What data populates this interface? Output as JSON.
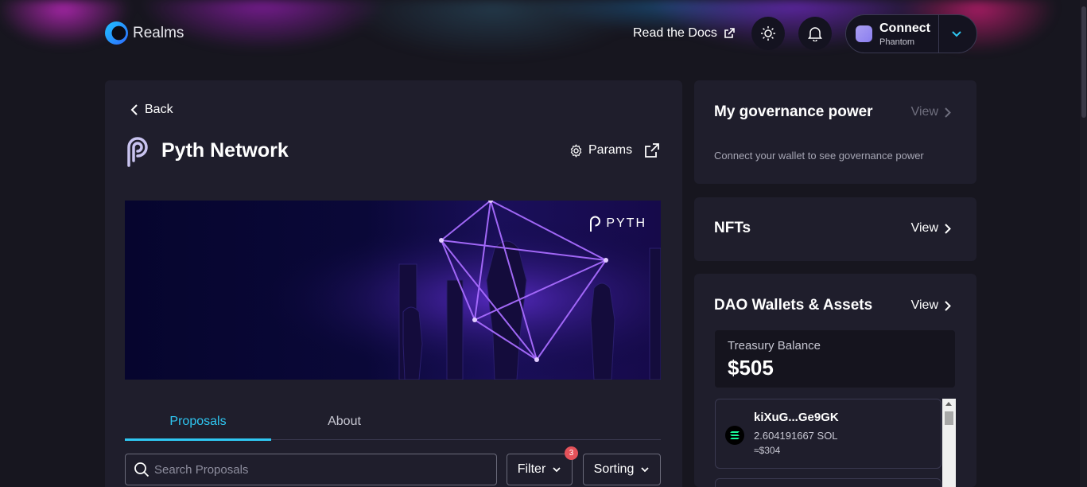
{
  "header": {
    "logo_text": "Realms",
    "docs_label": "Read the Docs",
    "connect_label": "Connect",
    "connect_sub": "Phantom"
  },
  "dao": {
    "back_label": "Back",
    "name": "Pyth Network",
    "params_label": "Params",
    "banner_brand": "PYTH"
  },
  "tabs": [
    {
      "label": "Proposals",
      "active": true
    },
    {
      "label": "About",
      "active": false
    }
  ],
  "proposals": {
    "search_placeholder": "Search Proposals",
    "filter_label": "Filter",
    "filter_count": "3",
    "sorting_label": "Sorting"
  },
  "sidebar": {
    "governance": {
      "title": "My governance power",
      "view_label": "View",
      "desc": "Connect your wallet to see governance power"
    },
    "nfts": {
      "title": "NFTs",
      "view_label": "View"
    },
    "assets": {
      "title": "DAO Wallets & Assets",
      "view_label": "View",
      "treasury_label": "Treasury Balance",
      "treasury_amount": "$505",
      "wallets": [
        {
          "name": "kiXuG...Ge9GK",
          "amount": "2.604191667 SOL",
          "usd": "≈$304"
        }
      ]
    }
  },
  "colors": {
    "accent": "#2fc7f2",
    "badge": "#e4525a",
    "panel": "#1f1e2c",
    "background": "#17161f"
  }
}
